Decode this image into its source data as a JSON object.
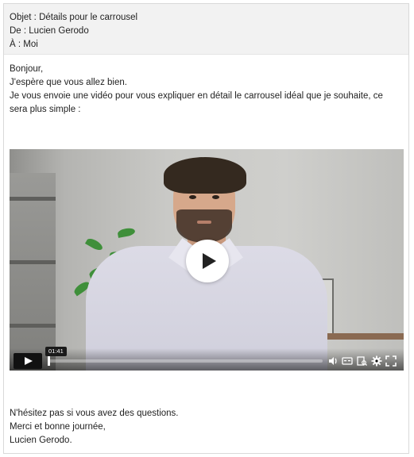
{
  "email": {
    "subject_line": "Objet : Détails pour le carrousel",
    "from_line": "De : Lucien Gerodo",
    "to_line": "À : Moi",
    "greeting": "Bonjour,",
    "intro_1": "J'espère que vous allez bien.",
    "intro_2": "Je vous envoie une vidéo pour vous expliquer en détail le carrousel idéal que je souhaite, ce sera plus simple :",
    "closing_1": "N'hésitez pas si vous avez des questions.",
    "closing_2": "Merci et bonne journée,",
    "signature": "Lucien Gerodo."
  },
  "video": {
    "timecode": "01:41",
    "progress": 0.0,
    "icons": [
      "play-icon",
      "volume-icon",
      "captions-icon",
      "transcript-icon",
      "settings-icon",
      "fullscreen-icon"
    ]
  },
  "colors": {
    "header_bg": "#f2f2f2",
    "control_bar": "#111111",
    "play_button": "#ffffff"
  }
}
